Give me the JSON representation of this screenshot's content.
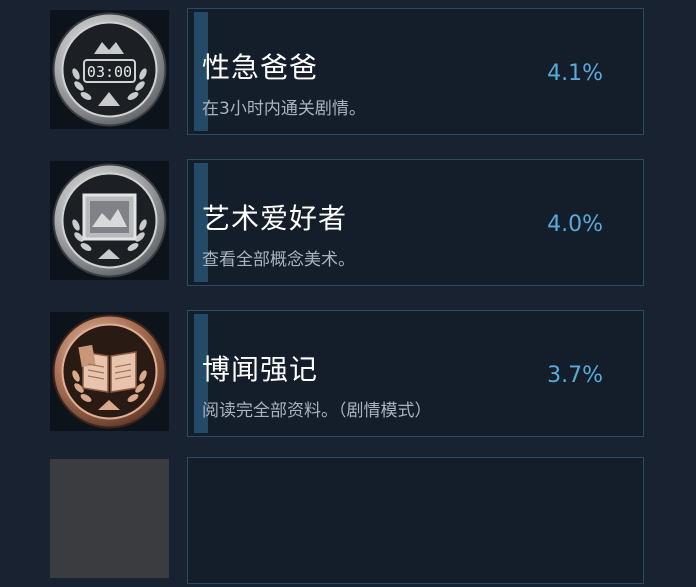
{
  "achievements": [
    {
      "title": "性急爸爸",
      "description": "在3小时内通关剧情。",
      "percent": "4.1%",
      "badge_icon": "clock-0300-icon",
      "badge_text": "03:00",
      "badge_style": "silver"
    },
    {
      "title": "艺术爱好者",
      "description": "查看全部概念美术。",
      "percent": "4.0%",
      "badge_icon": "picture-frame-icon",
      "badge_style": "silver"
    },
    {
      "title": "博闻强记",
      "description": "阅读完全部资料。（剧情模式）",
      "percent": "3.7%",
      "badge_icon": "open-book-icon",
      "badge_style": "bronze"
    }
  ],
  "colors": {
    "background": "#182230",
    "card_border": "#2d4a63",
    "accent_bar": "#234a66",
    "title": "#ffffff",
    "description": "#a7b3bf",
    "percent": "#5aa9db"
  }
}
